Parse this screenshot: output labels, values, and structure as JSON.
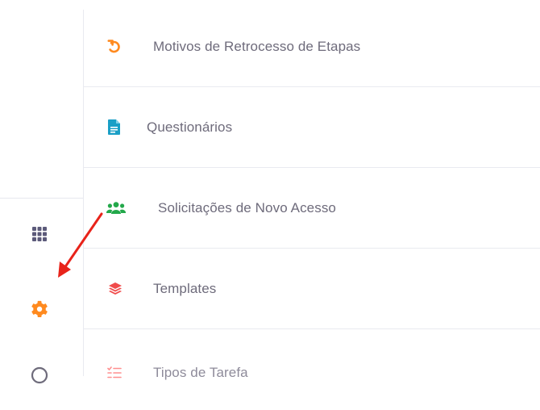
{
  "menu": {
    "items": [
      {
        "label": "Motivos de Retrocesso de Etapas",
        "icon": "undo-icon",
        "color": "#ff8a1f"
      },
      {
        "label": "Questionários",
        "icon": "file-text-icon",
        "color": "#1a9fc6"
      },
      {
        "label": "Solicitações de Novo Acesso",
        "icon": "users-icon",
        "color": "#23a84a"
      },
      {
        "label": "Templates",
        "icon": "layers-icon",
        "color": "#f04c4c"
      },
      {
        "label": "Tipos de Tarefa",
        "icon": "list-check-icon",
        "color": "#ff6b6b"
      }
    ]
  },
  "rail": {
    "icons": [
      {
        "icon": "grid-icon",
        "color": "#5c5a7a"
      },
      {
        "icon": "gear-icon",
        "color": "#ff8a1f"
      },
      {
        "icon": "circle-icon",
        "color": "#6e6b7b"
      }
    ]
  },
  "annotation": {
    "arrow_color": "#e8231a"
  }
}
